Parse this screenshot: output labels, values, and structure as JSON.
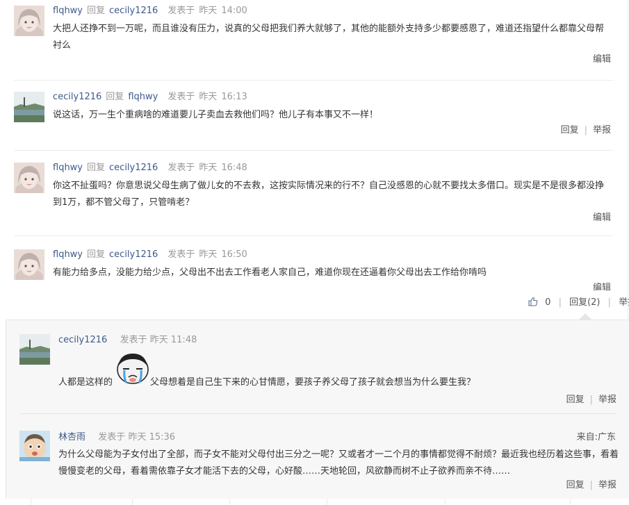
{
  "comments": [
    {
      "user": "flqhwy",
      "reply_word": "回复",
      "reply_to": "cecily1216",
      "posted": "发表于",
      "day": "昨天",
      "time": "14:00",
      "text": "大把人还挣不到一万呢，而且谁没有压力，说真的父母把我们养大就够了，其他的能额外支持多少都要感恩了，难道还指望什么都靠父母帮衬么",
      "edit": "编辑"
    },
    {
      "user": "cecily1216",
      "reply_word": "回复",
      "reply_to": "flqhwy",
      "posted": "发表于",
      "day": "昨天",
      "time": "16:13",
      "text": "说这话，万一生个重病啥的难道要儿子卖血去救他们吗？他儿子有本事又不一样！",
      "reply": "回复",
      "report": "举报"
    },
    {
      "user": "flqhwy",
      "reply_word": "回复",
      "reply_to": "cecily1216",
      "posted": "发表于",
      "day": "昨天",
      "time": "16:48",
      "text": "你这不扯蛋吗？你意思说父母生病了做儿女的不去救，这按实际情况来的行不？自己没感恩的心就不要找太多借口。现实是不是很多都没挣到1万，都不管父母了，只管啃老？",
      "edit": "编辑"
    },
    {
      "user": "flqhwy",
      "reply_word": "回复",
      "reply_to": "cecily1216",
      "posted": "发表于",
      "day": "昨天",
      "time": "16:50",
      "text": "有能力给多点，没能力给少点，父母出不出去工作看老人家自己，难道你现在还逼着你父母出去工作给你啃吗",
      "edit": "编辑"
    }
  ],
  "bar": {
    "like_count": "0",
    "reply_label": "回复(2)",
    "report": "举报"
  },
  "replies": [
    {
      "user": "cecily1216",
      "posted": "发表于",
      "day": "昨天",
      "time": "11:48",
      "text_before": "人都是这样的",
      "text_after": "父母想着是自己生下来的心甘情愿，要孩子养父母了孩子就会想当为什么要生我？",
      "reply": "回复",
      "report": "举报"
    },
    {
      "user": "林杏雨",
      "posted": "发表于",
      "day": "昨天",
      "time": "15:36",
      "source": "来自:广东",
      "text": "为什么父母能为子女付出了全部，而子女不能对父母付出三分之一呢？又或者才一二个月的事情都觉得不耐烦？最近我也经历着这些事，看着慢慢变老的父母，看着需依靠子女才能活下去的父母，心好酸……天地轮回，风欲静而树不止子欲养而亲不待……",
      "reply": "回复",
      "report": "举报"
    }
  ],
  "icons": {
    "like": "thumbs-up-icon",
    "emoji": "crying-emoji"
  },
  "colors": {
    "username": "#3d5a8a",
    "meta": "#999999",
    "text": "#333333",
    "reply_bg": "#f7f7f7"
  }
}
